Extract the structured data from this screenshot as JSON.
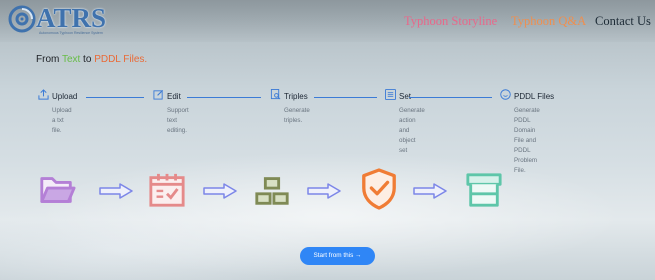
{
  "header": {
    "logo_text": "ATRS",
    "logo_subtitle": "Autonomous Typhoon Resilience System",
    "nav": {
      "storyline": "Typhoon Storyline",
      "qa": "Typhoon Q&A",
      "contact": "Contact Us"
    }
  },
  "headline": {
    "part1": "From ",
    "part2": "Text",
    "part3": " to ",
    "part4": "PDDL Files."
  },
  "steps": [
    {
      "title": "Upload",
      "desc": "Upload a txt file.",
      "icon": "upload-icon"
    },
    {
      "title": "Edit",
      "desc": "Support text editing.",
      "icon": "edit-icon"
    },
    {
      "title": "Triples",
      "desc": "Generate triples.",
      "icon": "document-search-icon"
    },
    {
      "title": "Set",
      "desc_lines": [
        "Generate action and",
        "object set"
      ],
      "icon": "list-box-icon"
    },
    {
      "title": "PDDL Files",
      "desc_lines": [
        "Generate PDDL",
        "Domain File and",
        "PDDL Problem File."
      ],
      "icon": "smile-circle-icon"
    }
  ],
  "flow_icons": [
    "folder-icon",
    "calendar-icon",
    "gold-bars-icon",
    "shield-check-icon",
    "shop-icon"
  ],
  "cta": {
    "label": "Start from this →"
  },
  "colors": {
    "accent_blue": "#3c7bd6",
    "green": "#67bd46",
    "orange": "#ea6a37",
    "nav_pink": "#e9678a",
    "nav_orange": "#ef8f4f"
  }
}
